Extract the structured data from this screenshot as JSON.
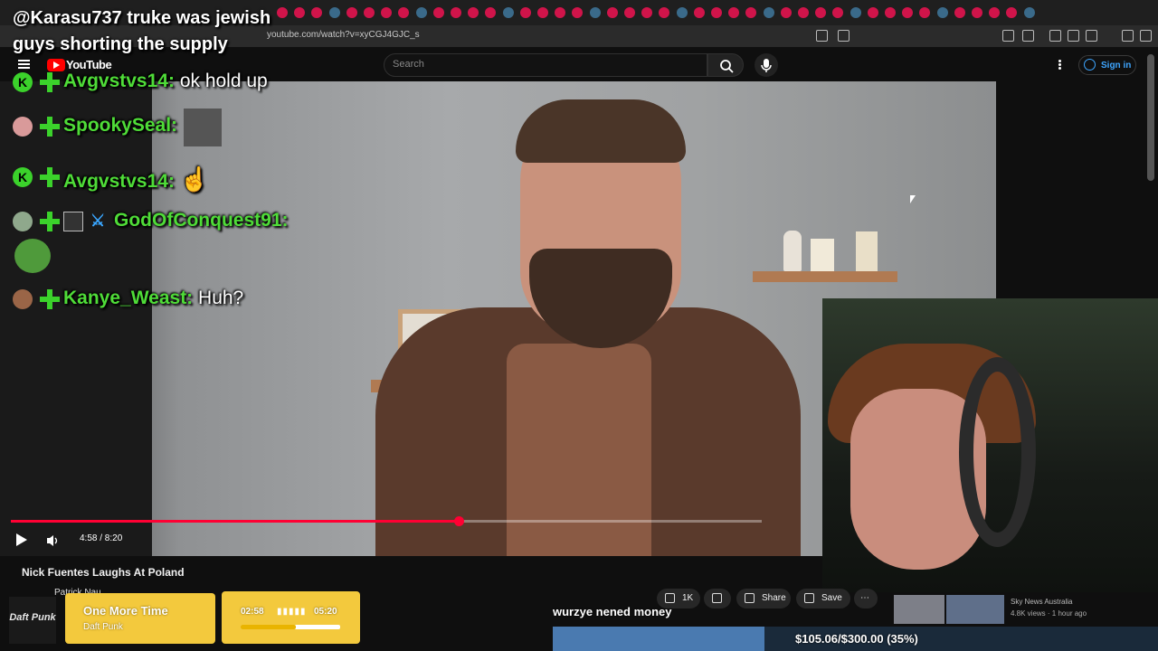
{
  "browser": {
    "url": "youtube.com/watch?v=xyCGJ4GJC_s"
  },
  "header": {
    "logo_text": "YouTube",
    "search_placeholder": "Search",
    "sign_in_label": "Sign in"
  },
  "player": {
    "time": "4:58 / 8:20",
    "progress_fraction": 0.596
  },
  "video": {
    "title": "Nick Fuentes Laughs At Poland",
    "channel": "Patrick Nau...",
    "actions": {
      "likes": "1K",
      "share": "Share",
      "save": "Save"
    }
  },
  "suggestion": {
    "channel": "Sky News Australia",
    "meta": "4.8K views · 1 hour ago"
  },
  "overlay": {
    "alert": "@Karasu737 truke was jewish guys shorting the supply",
    "chat": [
      {
        "user": "Avgvstvs14:",
        "msg": "ok hold up"
      },
      {
        "user": "SpookySeal:",
        "msg": ""
      },
      {
        "user": "Avgvstvs14:",
        "msg": "☝"
      },
      {
        "user": "GodOfConquest91:",
        "msg": ""
      },
      {
        "user": "Kanye_Weast:",
        "msg": "Huh?"
      }
    ],
    "now_playing": {
      "album_label": "Daft Punk",
      "title": "One More Time",
      "artist": "Daft Punk",
      "elapsed": "02:58",
      "total": "05:20",
      "progress_fraction": 0.556
    },
    "tts_message": "wurzye nened money",
    "goal": {
      "text": "$105.06/$300.00 (35%)",
      "fraction": 0.35,
      "color": "#4a7ab0"
    }
  },
  "colors": {
    "chat_user": "#4fdc38",
    "progress": "#ff0033",
    "now_playing_bg": "#f3c93d"
  }
}
